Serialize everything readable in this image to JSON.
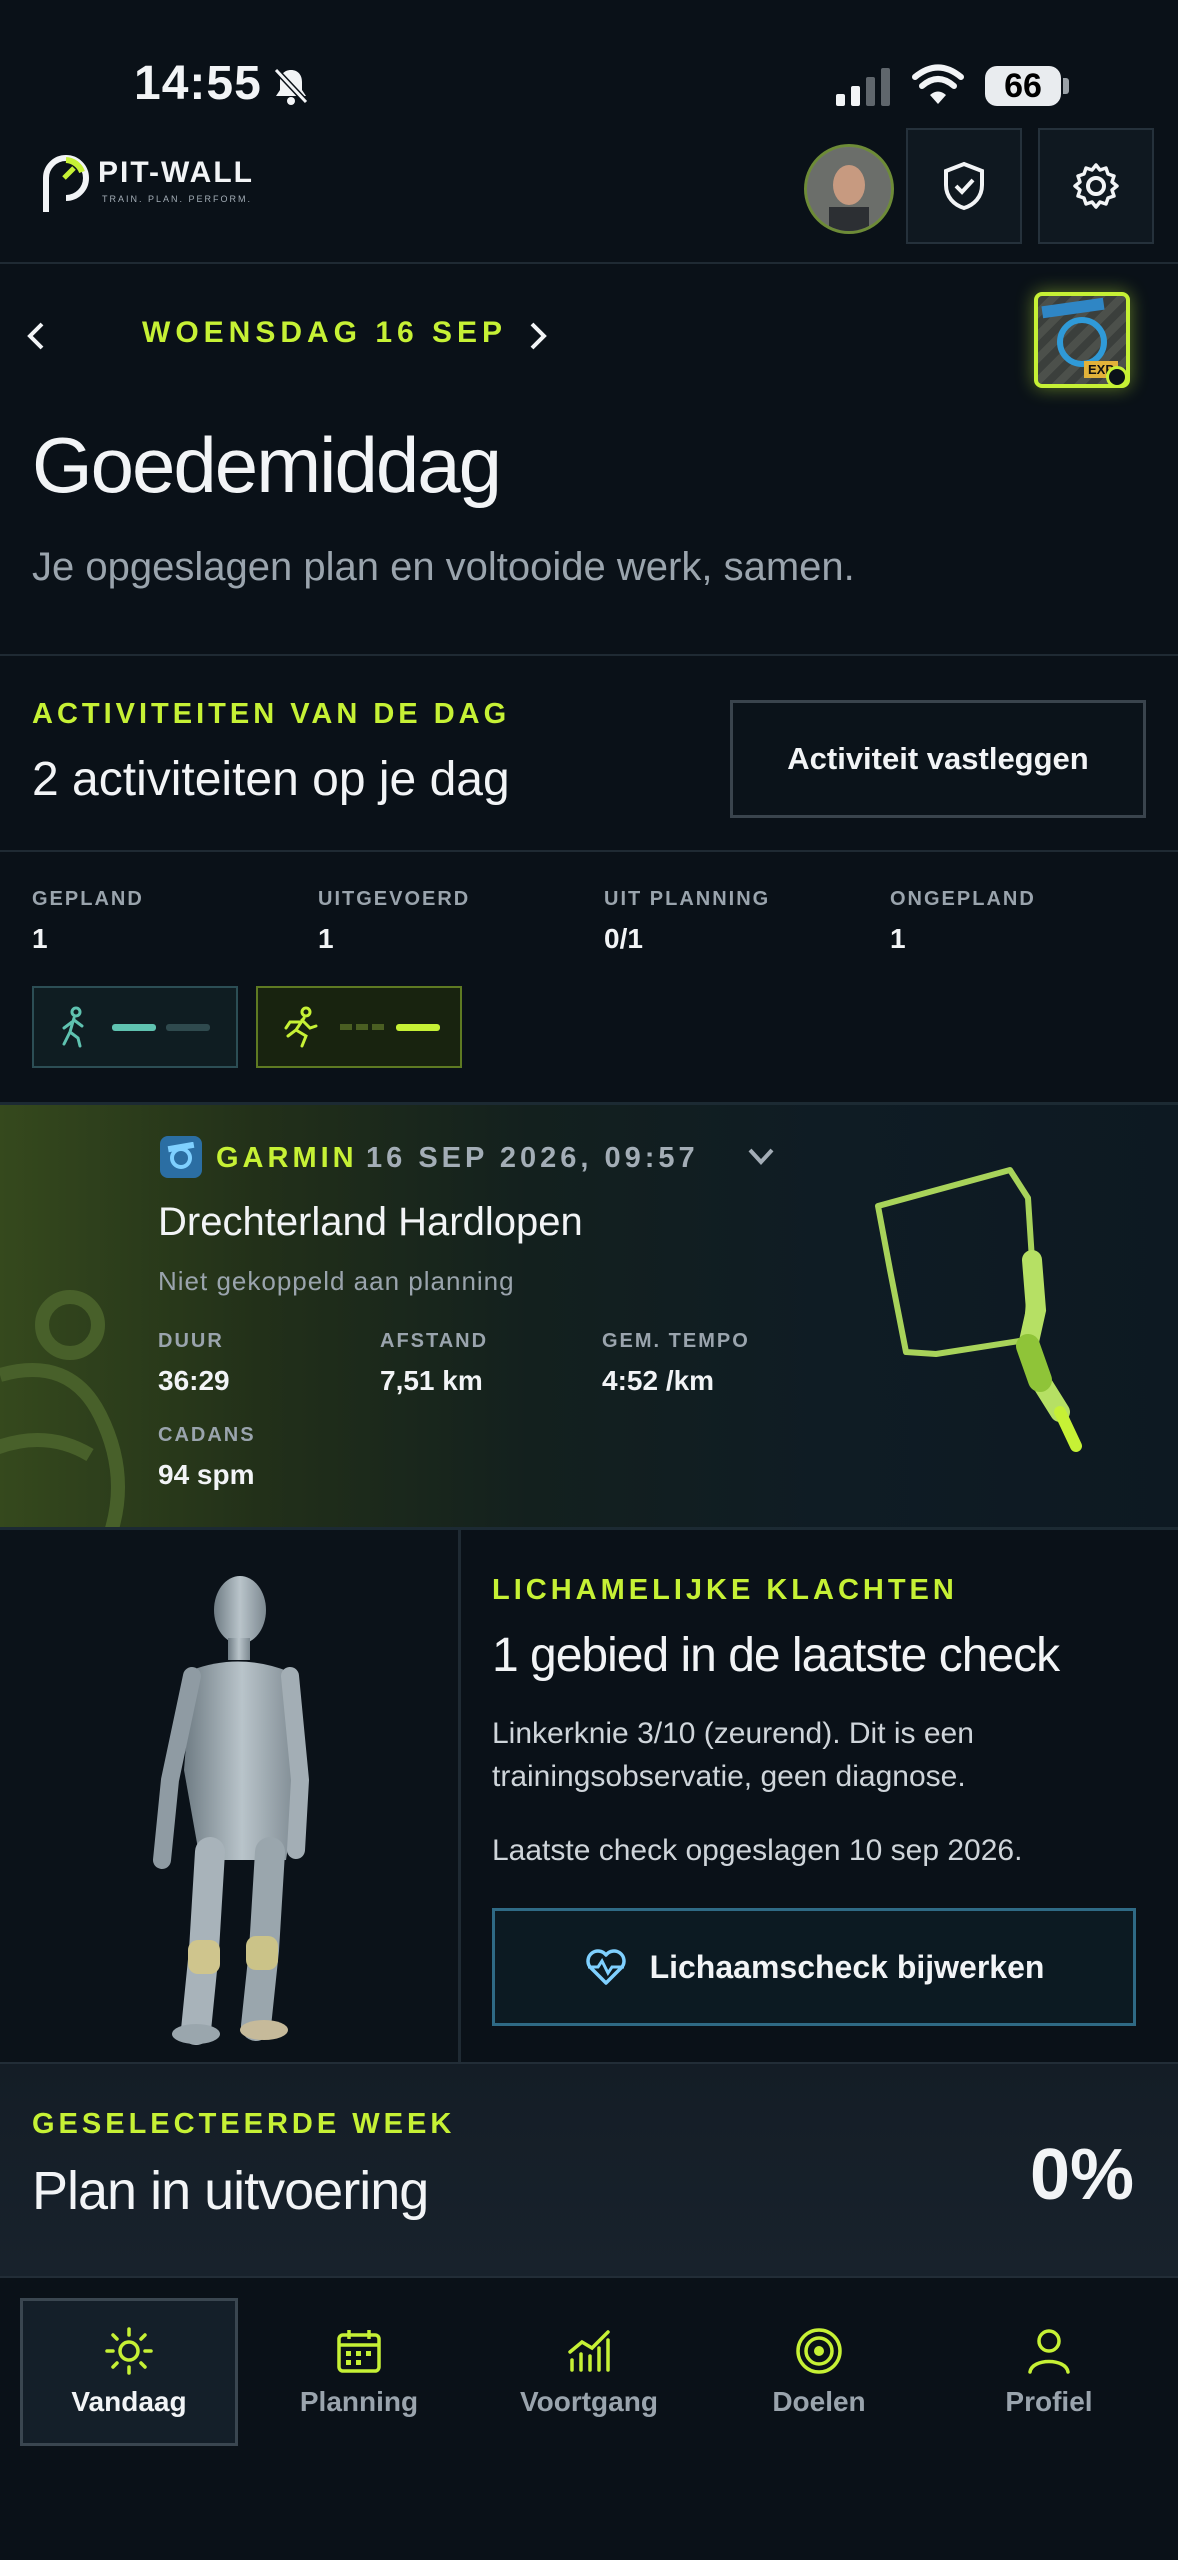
{
  "status_bar": {
    "time": "14:55",
    "battery": "66"
  },
  "header": {
    "brand": "PIT-WALL",
    "tagline": "TRAIN. PLAN. PERFORM."
  },
  "date_nav": {
    "label": "WOENSDAG 16 SEP",
    "badge_text": "EXP"
  },
  "greeting": {
    "title": "Goedemiddag",
    "subtitle": "Je opgeslagen plan en voltooide werk, samen."
  },
  "activities": {
    "section_label": "ACTIVITEITEN VAN DE DAG",
    "title": "2 activiteiten op je dag",
    "log_button": "Activiteit vastleggen",
    "stats": [
      {
        "label": "GEPLAND",
        "value": "1"
      },
      {
        "label": "UITGEVOERD",
        "value": "1"
      },
      {
        "label": "UIT PLANNING",
        "value": "0/1"
      },
      {
        "label": "ONGEPLAND",
        "value": "1"
      }
    ]
  },
  "garmin_activity": {
    "source": "GARMIN",
    "datetime": "16 SEP 2026, 09:57",
    "title": "Drechterland Hardlopen",
    "subtitle": "Niet gekoppeld aan planning",
    "metrics": [
      {
        "label": "DUUR",
        "value": "36:29"
      },
      {
        "label": "AFSTAND",
        "value": "7,51 km"
      },
      {
        "label": "GEM. TEMPO",
        "value": "4:52 /km"
      },
      {
        "label": "CADANS",
        "value": "94 spm"
      }
    ]
  },
  "body_check": {
    "section_label": "LICHAMELIJKE KLACHTEN",
    "title": "1 gebied in de laatste check",
    "description": "Linkerknie 3/10 (zeurend). Dit is een trainingsobservatie, geen diagnose.",
    "last_check": "Laatste check opgeslagen 10 sep 2026.",
    "button": "Lichaamscheck bijwerken"
  },
  "week": {
    "section_label": "GESELECTEERDE WEEK",
    "title": "Plan in uitvoering",
    "percent": "0%"
  },
  "tabs": [
    {
      "label": "Vandaag",
      "icon": "sun-icon",
      "active": true
    },
    {
      "label": "Planning",
      "icon": "calendar-icon",
      "active": false
    },
    {
      "label": "Voortgang",
      "icon": "chart-icon",
      "active": false
    },
    {
      "label": "Doelen",
      "icon": "target-icon",
      "active": false
    },
    {
      "label": "Profiel",
      "icon": "user-icon",
      "active": false
    }
  ],
  "colors": {
    "accent": "#c6f135",
    "background": "#0a1118",
    "link_border": "#2f6a85"
  }
}
